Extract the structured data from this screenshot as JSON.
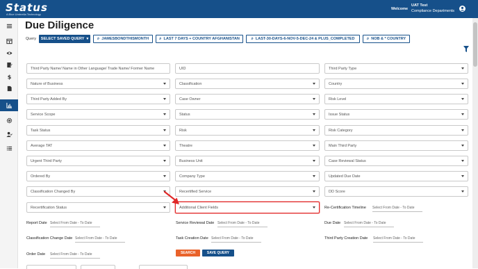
{
  "header": {
    "logo": "Status",
    "logo_tagline": "A Blue Umbrella Technology",
    "welcome": "Welcome",
    "user_name": "UAT Test",
    "user_dept": "Compliance Departments"
  },
  "page": {
    "title": "Due Diligence"
  },
  "query": {
    "label": "Query",
    "select_button": "SELECT SAVED QUERY",
    "saved": [
      "JAMESBONDTHISMONTH",
      "LAST 7 DAYS + COUNTRY AFGHANISTAN",
      "LAST-30-DAYS-6-NOV-5-DEC-24 & PLUS_COMPLETED",
      "NOB & * COUNTRY"
    ]
  },
  "fields": {
    "third_party_name": "Third Party Name/ Name in Other Language/ Trade Name/ Former Name",
    "uid": "UID",
    "third_party_type": "Third Party Type",
    "nature_of_business": "Nature of Business",
    "classification": "Classification",
    "country": "Country",
    "third_party_added_by": "Third Party Added By",
    "case_owner": "Case Owner",
    "risk_level": "Risk Level",
    "service_scope": "Service Scope",
    "status": "Status",
    "issue_status": "Issue Status",
    "task_status": "Task Status",
    "risk": "Risk",
    "risk_category": "Risk Category",
    "average_tat": "Average TAT",
    "theatre": "Theatre",
    "main_third_party": "Main Third Party",
    "urgent_third_party": "Urgent Third Party",
    "business_unit": "Business Unit",
    "case_reviewal_status": "Case Reviewal Status",
    "ordered_by": "Ordered By",
    "company_type": "Company Type",
    "updated_due_date": "Updated Due Date",
    "classification_changed_by": "Classification Changed By",
    "recertified_service": "Recertified Service",
    "dd_score": "DD Score",
    "recertification_status": "Recertification Status",
    "additional_client_fields": "Additional Client Fields"
  },
  "dates": {
    "placeholder": "Select From Date - To Date",
    "recert_timeline": "Re-Certification Timeline",
    "report_date": "Report Date",
    "service_reviewal_date": "Service Reviewal Date",
    "due_date": "Due Date",
    "classification_change_date": "Classification Change Date",
    "task_creation_date": "Task Creation Date",
    "third_party_creation_date": "Third Party Creation Date",
    "order_date": "Order Date"
  },
  "actions": {
    "search": "SEARCH",
    "save_query": "SAVE QUERY"
  },
  "colors": {
    "brand": "#16508a",
    "accent": "#e9622a",
    "highlight": "#e02828"
  }
}
